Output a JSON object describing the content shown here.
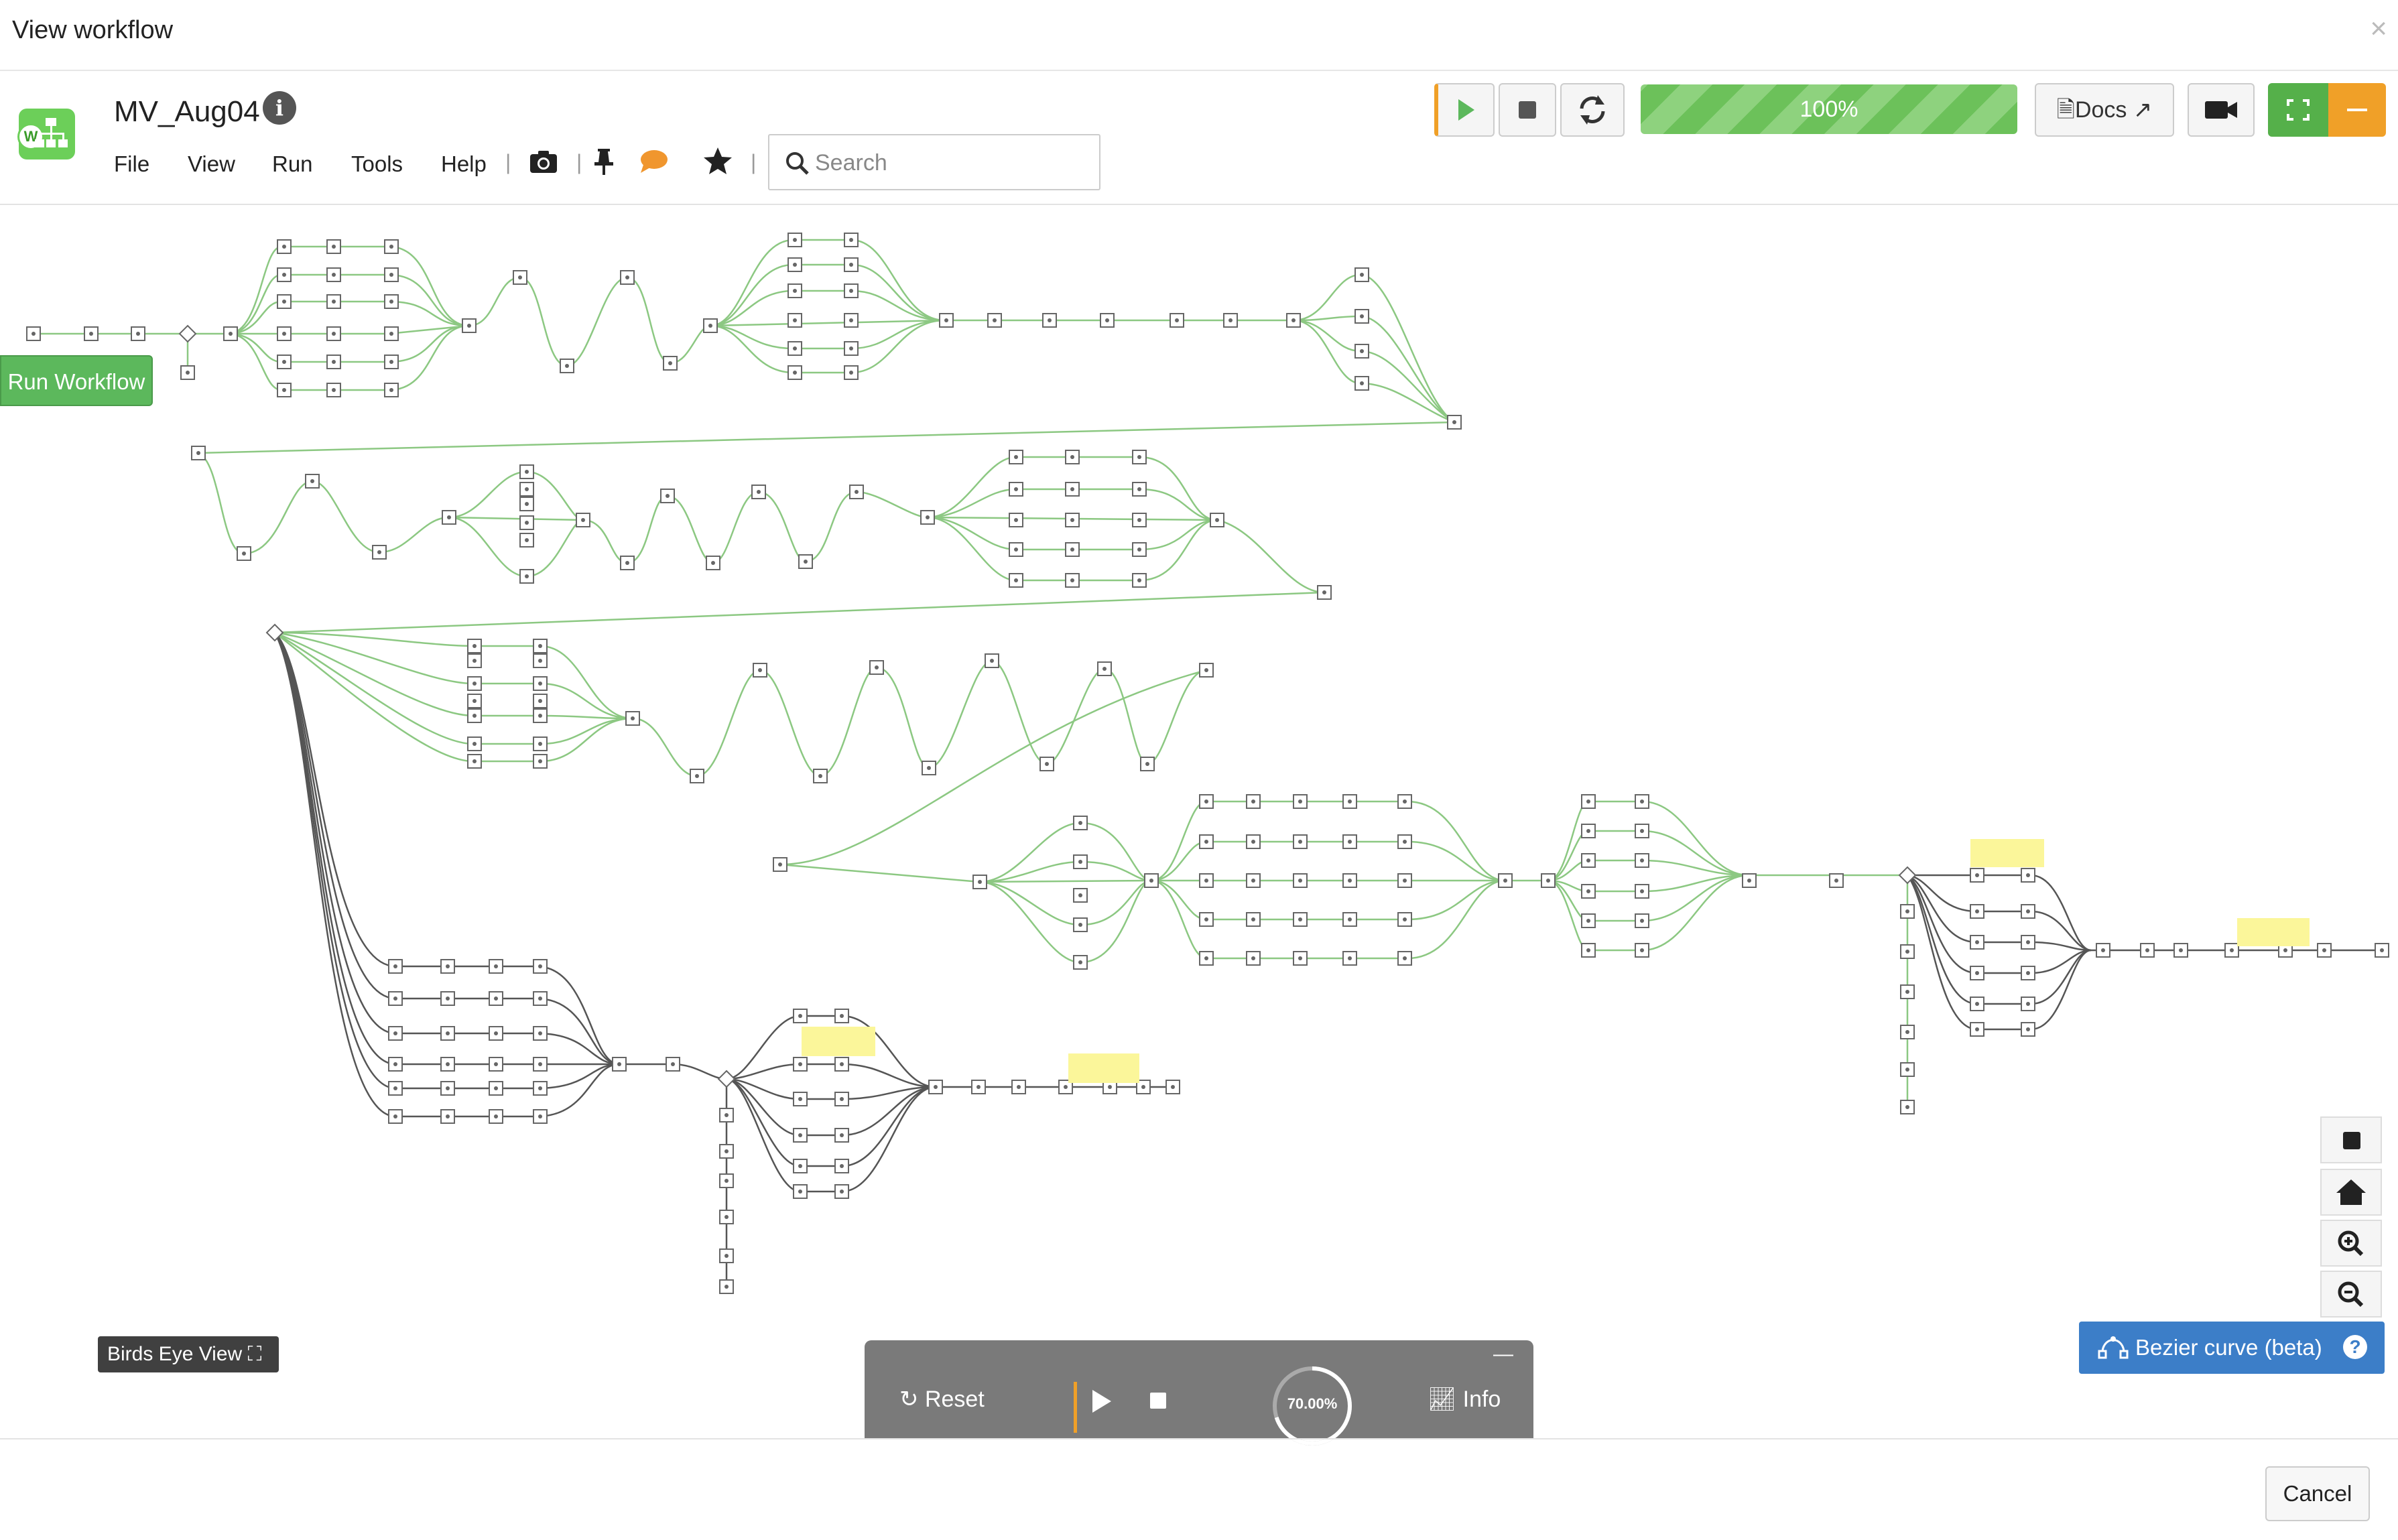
{
  "dialog": {
    "title": "View workflow",
    "close_glyph": "×"
  },
  "workflow": {
    "name": "MV_Aug04",
    "logo_badge": "W"
  },
  "menu": [
    "File",
    "View",
    "Run",
    "Tools",
    "Help"
  ],
  "toolbar_icons": [
    "camera-icon",
    "pin-icon",
    "comment-icon",
    "star-icon"
  ],
  "search": {
    "placeholder": "Search",
    "value": ""
  },
  "run_controls": [
    "play-icon",
    "stop-icon",
    "refresh-icon"
  ],
  "progress": {
    "label": "100%",
    "value": 1.0
  },
  "docs_label": "Docs",
  "canvas": {
    "run_workflow_label": "Run Workflow",
    "birds_eye_label": "Birds Eye View",
    "zoom_controls": [
      "stop-icon",
      "home-icon",
      "zoom-in-icon",
      "zoom-out-icon"
    ],
    "bezier_label": "Bezier curve (beta)"
  },
  "player": {
    "reset_label": "Reset",
    "progress_label": "70.00%",
    "progress_value": 0.7,
    "info_label": "Info",
    "minimize_glyph": "—"
  },
  "footer": {
    "cancel_label": "Cancel"
  },
  "colors": {
    "green": "#6cc15a",
    "orange": "#f0a028",
    "blue": "#3c7ec8",
    "dark_edge": "#555555",
    "green_edge": "#8cc882",
    "note": "#fbf69a"
  }
}
